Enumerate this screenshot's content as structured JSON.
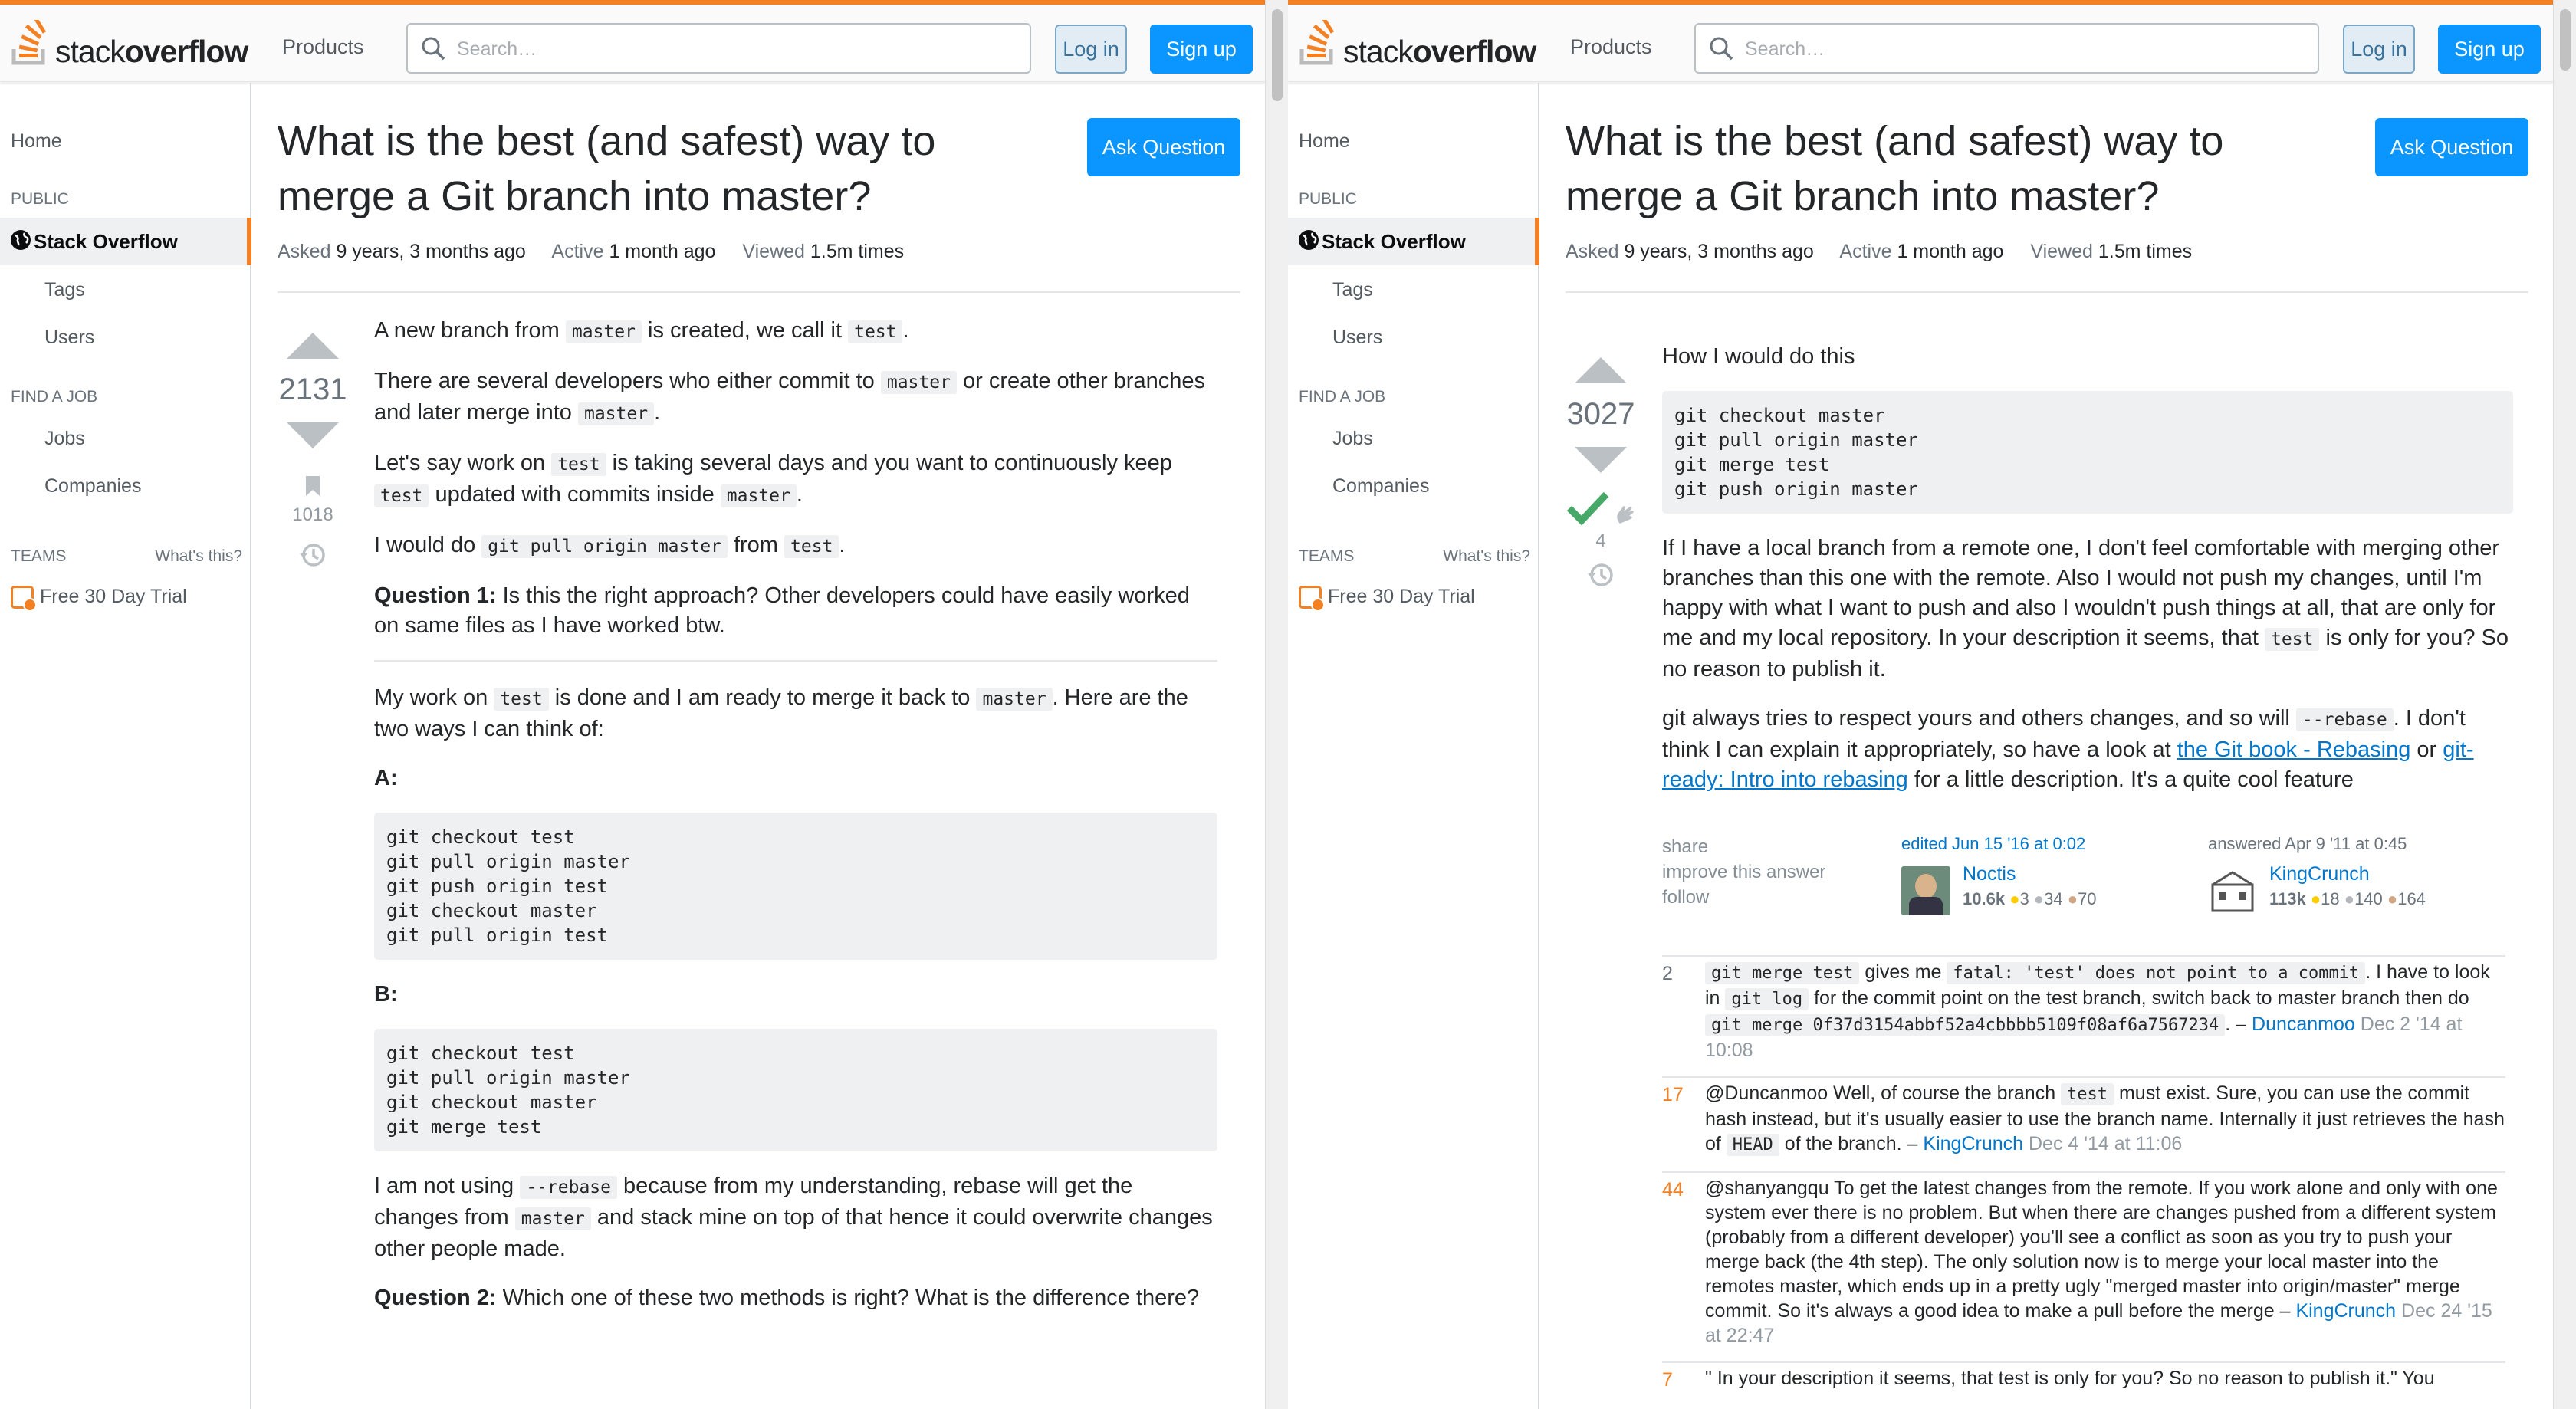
{
  "header": {
    "products_label": "Products",
    "search_placeholder": "Search…",
    "login_label": "Log in",
    "signup_label": "Sign up"
  },
  "sidebar": {
    "home": "Home",
    "public_heading": "PUBLIC",
    "stack_overflow": "Stack Overflow",
    "tags": "Tags",
    "users": "Users",
    "find_job_heading": "FIND A JOB",
    "jobs": "Jobs",
    "companies": "Companies",
    "teams_heading": "TEAMS",
    "whats_this": "What's this?",
    "free_trial": "Free 30 Day Trial"
  },
  "question": {
    "title": "What is the best (and safest) way to merge a Git branch into master?",
    "ask_button": "Ask Question",
    "asked_label": "Asked",
    "asked_value": "9 years, 3 months ago",
    "active_label": "Active",
    "active_value": "1 month ago",
    "viewed_label": "Viewed",
    "viewed_value": "1.5m times",
    "score": "2131",
    "bookmarks": "1018",
    "p1a": "A new branch from ",
    "p1c1": "master",
    "p1b": " is created, we call it ",
    "p1c2": "test",
    "p1d": ".",
    "p2a": "There are several developers who either commit to ",
    "p2c1": "master",
    "p2b": " or create other branches and later merge into ",
    "p2c2": "master",
    "p2d": ".",
    "p3a": "Let's say work on ",
    "p3c1": "test",
    "p3b": " is taking several days and you want to continuously keep ",
    "p3c2": "test",
    "p3c": " updated with commits inside ",
    "p3c3": "master",
    "p3d": ".",
    "p4a": "I would do ",
    "p4c1": "git pull origin master",
    "p4b": " from ",
    "p4c2": "test",
    "p4d": ".",
    "q1_label": "Question 1:",
    "q1_text": " Is this the right approach? Other developers could have easily worked on same files as I have worked btw.",
    "p5a": "My work on ",
    "p5c1": "test",
    "p5b": " is done and I am ready to merge it back to ",
    "p5c2": "master",
    "p5c": ". Here are the two ways I can think of:",
    "a_label": "A:",
    "code_a": "git checkout test\ngit pull origin master\ngit push origin test\ngit checkout master\ngit pull origin test",
    "b_label": "B:",
    "code_b": "git checkout test\ngit pull origin master\ngit checkout master\ngit merge test",
    "p6a": "I am not using ",
    "p6c1": "--rebase",
    "p6b": " because from my understanding, rebase will get the changes from ",
    "p6c2": "master",
    "p6c": " and stack mine on top of that hence it could overwrite changes other people made.",
    "q2_label": "Question 2:",
    "q2_text": " Which one of these two methods is right? What is the difference there?"
  },
  "answer": {
    "score": "3027",
    "bounty_count": "4",
    "intro": "How I would do this",
    "code": "git checkout master\ngit pull origin master\ngit merge test\ngit push origin master",
    "p1a": "If I have a local branch from a remote one, I don't feel comfortable with merging other branches than this one with the remote. Also I would not push my changes, until I'm happy with what I want to push and also I wouldn't push things at all, that are only for me and my local repository. In your description it seems, that ",
    "p1c": "test",
    "p1b": " is only for you? So no reason to publish it.",
    "p2a": "git always tries to respect yours and others changes, and so will ",
    "p2c": "--rebase",
    "p2b": ". I don't think I can explain it appropriately, so have a look at ",
    "link1": "the Git book - Rebasing",
    "p2mid": " or ",
    "link2": "git-ready: Intro into rebasing",
    "p2end": " for a little description. It's a quite cool feature",
    "share": "share",
    "improve": "improve this answer",
    "follow": "follow",
    "edited": "edited Jun 15 '16 at 0:02",
    "editor": "Noctis",
    "editor_rep": "10.6k",
    "editor_gold": "3",
    "editor_silver": "34",
    "editor_bronze": "70",
    "answered": "answered Apr 9 '11 at 0:45",
    "author": "KingCrunch",
    "author_rep": "113k",
    "author_gold": "18",
    "author_silver": "140",
    "author_bronze": "164"
  },
  "comments": [
    {
      "score": "2",
      "hot": false,
      "parts": [
        [
          "c",
          "git merge test"
        ],
        [
          "t",
          " gives me "
        ],
        [
          "c",
          "fatal: 'test' does not point to a commit"
        ],
        [
          "t",
          ". I have to look in "
        ],
        [
          "c",
          "git log"
        ],
        [
          "t",
          " for the commit point on the test branch, switch back to master branch then do "
        ],
        [
          "c",
          "git merge 0f37d3154abbf52a4cbbbb5109f08af6a7567234"
        ],
        [
          "t",
          "."
        ]
      ],
      "user": "Duncanmoo",
      "time": "Dec 2 '14 at 10:08"
    },
    {
      "score": "17",
      "hot": true,
      "parts": [
        [
          "t",
          "@Duncanmoo Well, of course the branch "
        ],
        [
          "c",
          "test"
        ],
        [
          "t",
          " must exist. Sure, you can use the commit hash instead, but it's usually easier to use the branch name. Internally it just retrieves the hash of "
        ],
        [
          "c",
          "HEAD"
        ],
        [
          "t",
          " of the branch."
        ]
      ],
      "user": "KingCrunch",
      "time": "Dec 4 '14 at 11:06"
    },
    {
      "score": "44",
      "hot": true,
      "parts": [
        [
          "t",
          "@shanyangqu To get the latest changes from the remote. If you work alone and only with one system ever there is no problem. But when there are changes pushed from a different system (probably from a different developer) you'll see a conflict as soon as you try to push your merge back (the 4th step). The only solution now is to merge your local master into the remotes master, which ends up in a pretty ugly \"merged master into origin/master\" merge commit. So it's always a good idea to make a pull before the merge"
        ]
      ],
      "user": "KingCrunch",
      "time": "Dec 24 '15 at 22:47"
    },
    {
      "score": "7",
      "hot": true,
      "parts": [
        [
          "t",
          "\" In your description it seems, that test is only for you? So no reason to publish it.\" You"
        ]
      ],
      "user": "",
      "time": ""
    }
  ]
}
